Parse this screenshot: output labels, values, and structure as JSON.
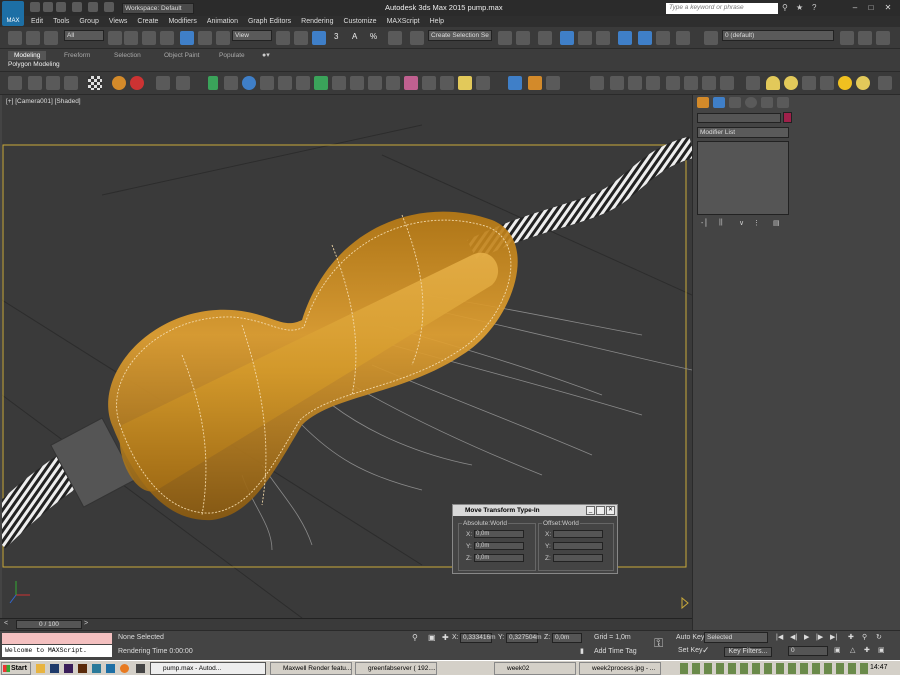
{
  "app": {
    "title": "Autodesk 3ds Max 2015    pump.max",
    "workspace_label": "Workspace: Default",
    "search_placeholder": "Type a keyword or phrase",
    "max_logo": "MAX"
  },
  "menu": [
    "Edit",
    "Tools",
    "Group",
    "Views",
    "Create",
    "Modifiers",
    "Animation",
    "Graph Editors",
    "Rendering",
    "Customize",
    "MAXScript",
    "Help"
  ],
  "toolbar": {
    "filter_value": "All",
    "coord_value": "View",
    "selection_set_placeholder": "Create Selection Se",
    "layer_value": "0 (default)",
    "snap_label": "3",
    "angle_snap_label": "A",
    "percent_snap_label": "%"
  },
  "ribbon": {
    "tabs": [
      "Modeling",
      "Freeform",
      "Selection",
      "Object Paint",
      "Populate"
    ],
    "active_tab": "Modeling",
    "subpanel": "Polygon Modeling"
  },
  "viewport": {
    "label": "[+] [Camera001] [Shaded]"
  },
  "command_panel": {
    "modifier_list": "Modifier List"
  },
  "timeline": {
    "frame": "0 / 100"
  },
  "dialog": {
    "title": "Move Transform Type-In",
    "absolute_label": "Absolute:World",
    "offset_label": "Offset:World",
    "axes": [
      "X:",
      "Y:",
      "Z:"
    ],
    "absolute_values": [
      "0,0m",
      "0,0m",
      "0,0m"
    ],
    "offset_values": [
      "",
      "",
      ""
    ]
  },
  "status": {
    "maxscript_text": "Welcome to MAXScript.",
    "selection_text": "None Selected",
    "render_time": "Rendering Time  0:00:00",
    "x_label": "X:",
    "x_value": "0,333416m",
    "y_label": "Y:",
    "y_value": "0,327504m",
    "z_label": "Z:",
    "z_value": "0,0m",
    "grid": "Grid = 1,0m",
    "add_time_tag": "Add Time Tag",
    "auto_key": "Auto Key",
    "set_key": "Set Key",
    "selected_value": "Selected",
    "key_filters": "Key Filters...",
    "frame_value": "0"
  },
  "taskbar": {
    "start": "Start",
    "items": [
      "pump.max - Autod...",
      "Maxwell Render featu...",
      "greenfabserver ( 192....",
      "week02",
      "week2process.jpg - ..."
    ],
    "active_index": 0,
    "clock": "14:47"
  },
  "colors": {
    "accent_blue": "#3f7fc8",
    "gold": "#d49a2a",
    "viewport_bg": "#3a3a3a",
    "safe_frame": "#c9a93a"
  }
}
